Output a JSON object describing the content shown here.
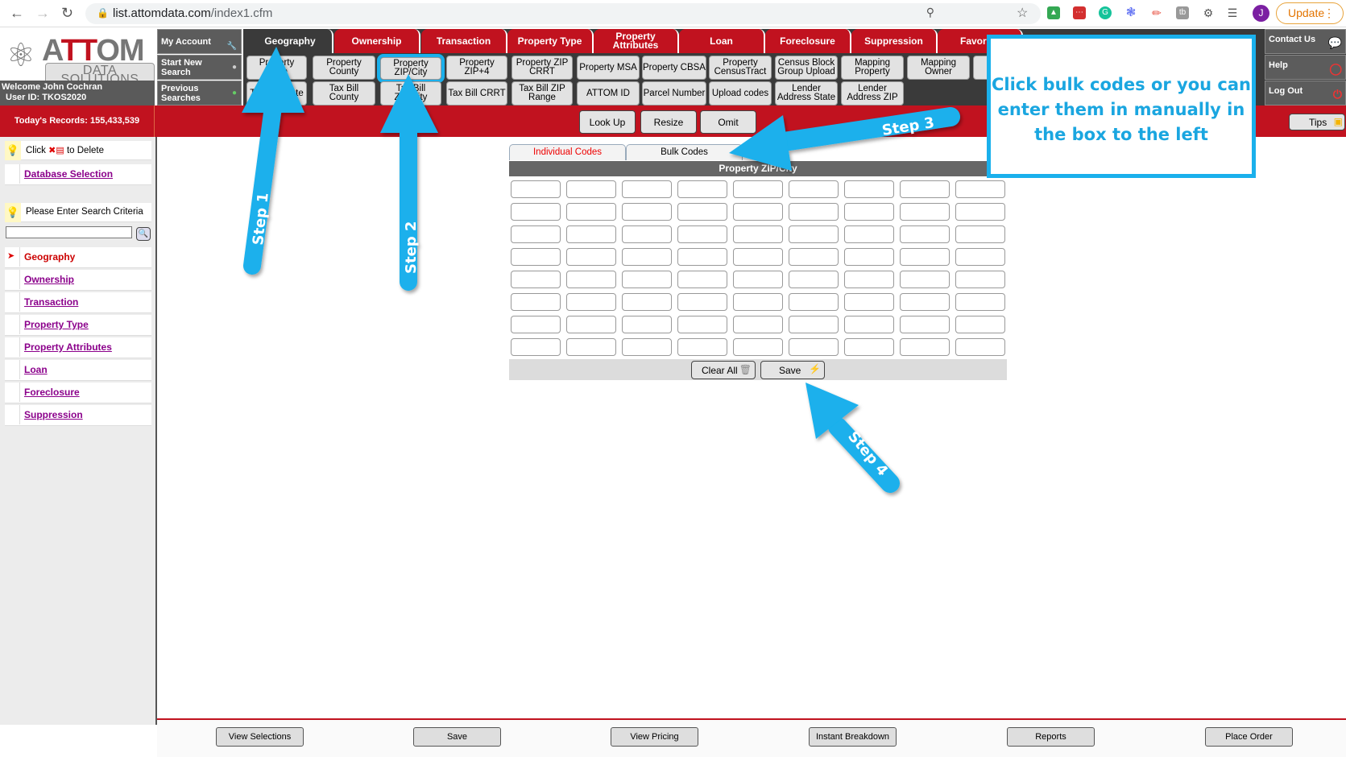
{
  "browser": {
    "url_host": "list.attomdata.com",
    "url_path": "/index1.cfm",
    "avatar_letter": "J",
    "update_label": "Update"
  },
  "header": {
    "logo_brand_a": "A",
    "logo_brand_tt": "TT",
    "logo_brand_om": "OM",
    "logo_sub": "DATA SOLUTIONS",
    "welcome": "Welcome John Cochran",
    "user_id": "User ID: TKOS2020",
    "records": "Today's Records: 155,433,539",
    "left_menu": [
      "My Account",
      "Start New Search",
      "Previous Searches"
    ],
    "right_menu": [
      "Contact Us",
      "Help",
      "Log Out"
    ],
    "tips_label": "Tips"
  },
  "tabs": [
    "Geography",
    "Ownership",
    "Transaction",
    "Property Type",
    "Property Attributes",
    "Loan",
    "Foreclosure",
    "Suppression",
    "Favorites"
  ],
  "subtabs_row1": [
    "Property State",
    "Property County",
    "Property ZIP/City",
    "Property ZIP+4",
    "Property ZIP CRRT",
    "Property MSA",
    "Property CBSA",
    "Property CensusTract",
    "Census Block Group Upload",
    "Mapping Property",
    "Mapping Owner",
    ""
  ],
  "subtabs_row2": [
    "Tax Bill State",
    "Tax Bill County",
    "Tax Bill ZIP/City",
    "Tax Bill CRRT",
    "Tax Bill ZIP Range",
    "ATTOM ID",
    "Parcel Number",
    "Upload codes",
    "Lender Address State",
    "Lender Address ZIP"
  ],
  "actions": [
    "Look Up",
    "Resize",
    "Omit"
  ],
  "sidebar": {
    "delete_hint_pre": "Click",
    "delete_hint_post": "to Delete",
    "database_selection": "Database Selection",
    "criteria_prompt": "Please Enter Search Criteria",
    "search_value": "",
    "items": [
      {
        "label": "Geography",
        "current": true
      },
      {
        "label": "Ownership"
      },
      {
        "label": "Transaction"
      },
      {
        "label": "Property Type"
      },
      {
        "label": "Property Attributes"
      },
      {
        "label": "Loan"
      },
      {
        "label": "Foreclosure"
      },
      {
        "label": "Suppression"
      }
    ]
  },
  "codes_panel": {
    "tabs": [
      "Individual Codes",
      "Bulk Codes"
    ],
    "active_tab": "Individual Codes",
    "title": "Property ZIP/City",
    "rows": 8,
    "cols": 9,
    "clear_all": "Clear All",
    "save": "Save"
  },
  "bottom_buttons": [
    "View Selections",
    "Save",
    "View Pricing",
    "Instant Breakdown",
    "Reports",
    "Place Order"
  ],
  "annotations": {
    "callout": "Click bulk codes or you can enter them in manually in the box to the left",
    "steps": [
      "Step 1",
      "Step 2",
      "Step 3",
      "Step 4"
    ],
    "color": "#1ab0ec"
  },
  "colors": {
    "brand_red": "#c1121f",
    "dark_gray": "#3a3a3a",
    "link_purple": "#8b008b"
  }
}
